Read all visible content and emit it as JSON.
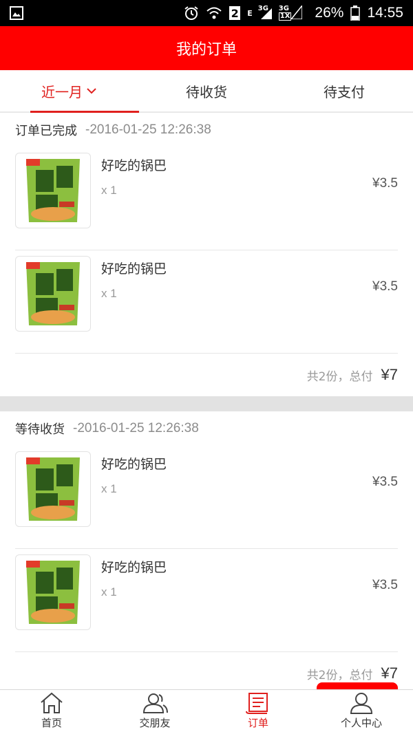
{
  "status_bar": {
    "network_labels": [
      "E",
      "3G",
      "3G",
      "1X"
    ],
    "sim_slot": "2",
    "battery": "26%",
    "time": "14:55"
  },
  "header": {
    "title": "我的订单"
  },
  "tabs": [
    {
      "label": "近一月",
      "active": true
    },
    {
      "label": "待收货",
      "active": false
    },
    {
      "label": "待支付",
      "active": false
    }
  ],
  "orders": [
    {
      "status": "订单已完成",
      "time": "-2016-01-25 12:26:38",
      "items": [
        {
          "name": "好吃的锅巴",
          "qty": "x 1",
          "price": "¥3.5"
        },
        {
          "name": "好吃的锅巴",
          "qty": "x 1",
          "price": "¥3.5"
        }
      ],
      "summary": "共2份，总付",
      "total": "¥7"
    },
    {
      "status": "等待收货",
      "time": "-2016-01-25 12:26:38",
      "items": [
        {
          "name": "好吃的锅巴",
          "qty": "x 1",
          "price": "¥3.5"
        },
        {
          "name": "好吃的锅巴",
          "qty": "x 1",
          "price": "¥3.5"
        }
      ],
      "summary": "共2份，总付",
      "total": "¥7"
    }
  ],
  "bottom_nav": [
    {
      "label": "首页",
      "icon": "home-icon",
      "active": false
    },
    {
      "label": "交朋友",
      "icon": "friends-icon",
      "active": false
    },
    {
      "label": "订单",
      "icon": "order-icon",
      "active": true
    },
    {
      "label": "个人中心",
      "icon": "profile-icon",
      "active": false
    }
  ],
  "colors": {
    "brand": "#ff0000",
    "active": "#e0201e"
  }
}
